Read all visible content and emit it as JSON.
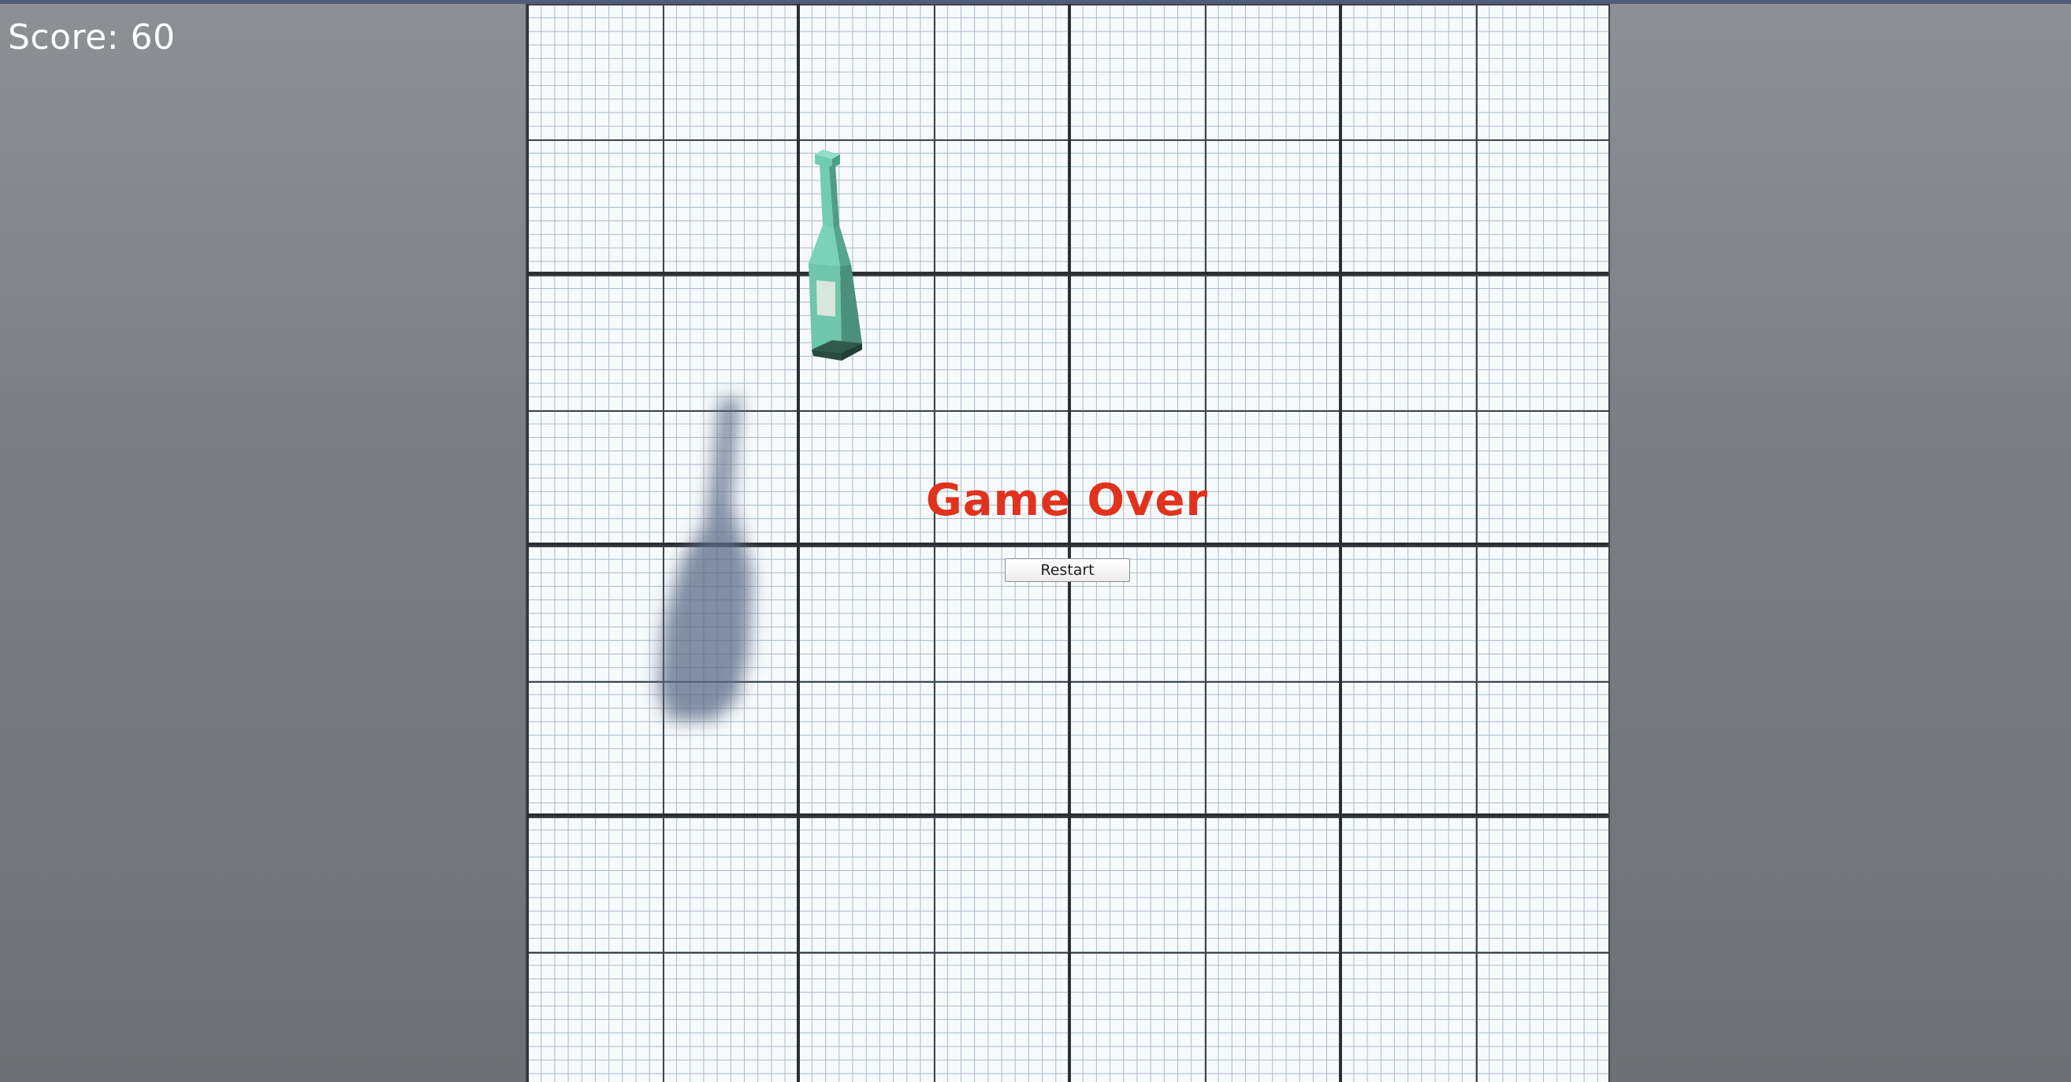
{
  "hud": {
    "score_text": "Score: 60"
  },
  "game_over": {
    "title": "Game Over",
    "restart_label": "Restart"
  },
  "colors": {
    "title": "#e1321e",
    "bottle_light": "#72ccb0",
    "bottle_dark": "#3c7a66",
    "board": "#f7fafb"
  },
  "objects": {
    "bottle_icon": "bottle-icon",
    "shadow_icon": "bottle-shadow-icon"
  }
}
